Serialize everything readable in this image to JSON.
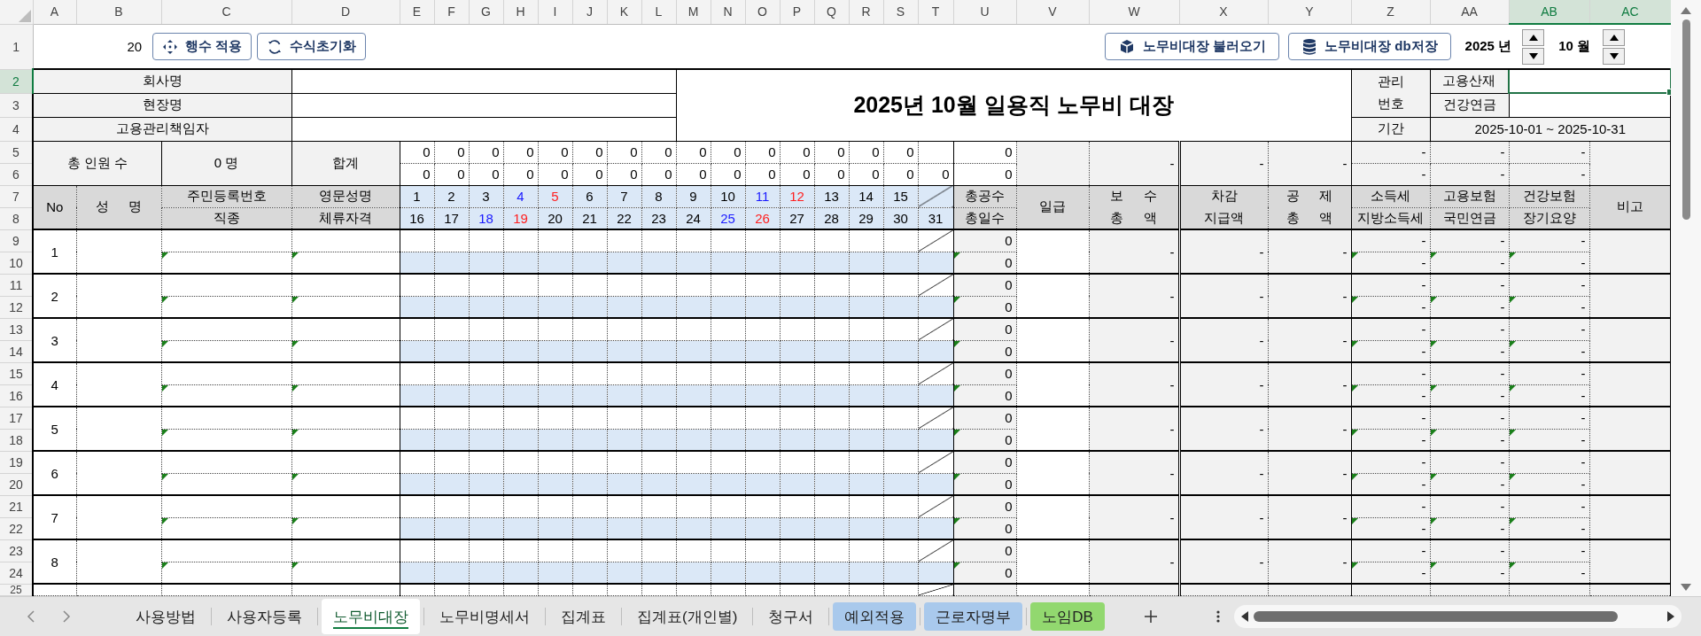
{
  "column_headers": [
    {
      "label": "A",
      "selected": false
    },
    {
      "label": "B",
      "selected": false
    },
    {
      "label": "C",
      "selected": false
    },
    {
      "label": "D",
      "selected": false
    },
    {
      "label": "E",
      "selected": false
    },
    {
      "label": "F",
      "selected": false
    },
    {
      "label": "G",
      "selected": false
    },
    {
      "label": "H",
      "selected": false
    },
    {
      "label": "I",
      "selected": false
    },
    {
      "label": "J",
      "selected": false
    },
    {
      "label": "K",
      "selected": false
    },
    {
      "label": "L",
      "selected": false
    },
    {
      "label": "M",
      "selected": false
    },
    {
      "label": "N",
      "selected": false
    },
    {
      "label": "O",
      "selected": false
    },
    {
      "label": "P",
      "selected": false
    },
    {
      "label": "Q",
      "selected": false
    },
    {
      "label": "R",
      "selected": false
    },
    {
      "label": "S",
      "selected": false
    },
    {
      "label": "T",
      "selected": false
    },
    {
      "label": "U",
      "selected": false
    },
    {
      "label": "V",
      "selected": false
    },
    {
      "label": "W",
      "selected": false
    },
    {
      "label": "X",
      "selected": false
    },
    {
      "label": "Y",
      "selected": false
    },
    {
      "label": "Z",
      "selected": false
    },
    {
      "label": "AA",
      "selected": false
    },
    {
      "label": "AB",
      "selected": true
    },
    {
      "label": "AC",
      "selected": true
    }
  ],
  "row_numbers": [
    {
      "label": "1",
      "selected": false
    },
    {
      "label": "2",
      "selected": true
    },
    {
      "label": "3",
      "selected": false
    },
    {
      "label": "4",
      "selected": false
    },
    {
      "label": "5",
      "selected": false
    },
    {
      "label": "6",
      "selected": false
    },
    {
      "label": "7",
      "selected": false
    },
    {
      "label": "8",
      "selected": false
    },
    {
      "label": "9",
      "selected": false
    },
    {
      "label": "10",
      "selected": false
    },
    {
      "label": "11",
      "selected": false
    },
    {
      "label": "12",
      "selected": false
    },
    {
      "label": "13",
      "selected": false
    },
    {
      "label": "14",
      "selected": false
    },
    {
      "label": "15",
      "selected": false
    },
    {
      "label": "16",
      "selected": false
    },
    {
      "label": "17",
      "selected": false
    },
    {
      "label": "18",
      "selected": false
    },
    {
      "label": "19",
      "selected": false
    },
    {
      "label": "20",
      "selected": false
    },
    {
      "label": "21",
      "selected": false
    },
    {
      "label": "22",
      "selected": false
    },
    {
      "label": "23",
      "selected": false
    },
    {
      "label": "24",
      "selected": false
    },
    {
      "label": "25",
      "selected": false
    }
  ],
  "toolbar": {
    "row_count": "20",
    "apply_rows_button": "행수 적용",
    "reset_formula_button": "수식초기화",
    "load_button": "노무비대장 불러오기",
    "save_db_button": "노무비대장 db저장",
    "year": {
      "value": "2025",
      "unit": "년"
    },
    "month": {
      "value": "10",
      "unit": "월"
    }
  },
  "header_block": {
    "company_label": "회사명",
    "site_label": "현장명",
    "manager_label": "고용관리책임자",
    "title": "2025년 10월 일용직 노무비 대장",
    "mgmt_labels": [
      "관리",
      "번호"
    ],
    "insurance_labels": [
      "고용산재",
      "건강연금"
    ],
    "period_label": "기간",
    "period": "2025-10-01 ~ 2025-10-31"
  },
  "summary": {
    "headcount_label": "총 인원 수",
    "headcount": "0 명",
    "sum_label": "합계",
    "first_half": [
      "0",
      "0",
      "0",
      "0",
      "0",
      "0",
      "0",
      "0",
      "0",
      "0",
      "0",
      "0",
      "0",
      "0",
      "0"
    ],
    "second_half": [
      "0",
      "0",
      "0",
      "0",
      "0",
      "0",
      "0",
      "0",
      "0",
      "0",
      "0",
      "0",
      "0",
      "0",
      "0",
      "0"
    ],
    "total_work": [
      "0",
      "0"
    ],
    "pay_total": "-",
    "net_pay": "-",
    "deduction_total": "-",
    "taxes": [
      [
        "-",
        "-"
      ],
      [
        "-",
        "-"
      ],
      [
        "-",
        "-"
      ]
    ]
  },
  "column_titles": {
    "no": "No",
    "name": "성 명",
    "id_job": [
      "주민등록번호",
      "직종"
    ],
    "eng_visa": [
      "영문성명",
      "체류자격"
    ],
    "work_days": [
      "총공수",
      "총일수"
    ],
    "daily_wage": "일급",
    "pay": [
      "보 수",
      "총 액"
    ],
    "net": [
      "차감",
      "지급액"
    ],
    "deduction": [
      "공 제",
      "총 액"
    ],
    "tax": [
      "소득세",
      "지방소득세"
    ],
    "insurance1": [
      "고용보험",
      "국민연금"
    ],
    "insurance2": [
      "건강보험",
      "장기요양"
    ],
    "note": "비고"
  },
  "days": [
    {
      "label": "1",
      "kind": "weekday"
    },
    {
      "label": "2",
      "kind": "weekday"
    },
    {
      "label": "3",
      "kind": "weekday"
    },
    {
      "label": "4",
      "kind": "saturday"
    },
    {
      "label": "5",
      "kind": "sunday"
    },
    {
      "label": "6",
      "kind": "weekday"
    },
    {
      "label": "7",
      "kind": "weekday"
    },
    {
      "label": "8",
      "kind": "weekday"
    },
    {
      "label": "9",
      "kind": "weekday"
    },
    {
      "label": "10",
      "kind": "weekday"
    },
    {
      "label": "11",
      "kind": "saturday"
    },
    {
      "label": "12",
      "kind": "sunday"
    },
    {
      "label": "13",
      "kind": "weekday"
    },
    {
      "label": "14",
      "kind": "weekday"
    },
    {
      "label": "15",
      "kind": "weekday"
    },
    {
      "label": "16",
      "kind": "weekday"
    },
    {
      "label": "17",
      "kind": "weekday"
    },
    {
      "label": "18",
      "kind": "saturday"
    },
    {
      "label": "19",
      "kind": "sunday"
    },
    {
      "label": "20",
      "kind": "weekday"
    },
    {
      "label": "21",
      "kind": "weekday"
    },
    {
      "label": "22",
      "kind": "weekday"
    },
    {
      "label": "23",
      "kind": "weekday"
    },
    {
      "label": "24",
      "kind": "weekday"
    },
    {
      "label": "25",
      "kind": "saturday"
    },
    {
      "label": "26",
      "kind": "sunday"
    },
    {
      "label": "27",
      "kind": "weekday"
    },
    {
      "label": "28",
      "kind": "weekday"
    },
    {
      "label": "29",
      "kind": "weekday"
    },
    {
      "label": "30",
      "kind": "weekday"
    },
    {
      "label": "31",
      "kind": "weekday"
    }
  ],
  "workers": [
    {
      "no": "1",
      "work": "0",
      "days": "0",
      "pay_total": "-",
      "net_pay": "-",
      "deduction_total": "-",
      "income_tax": "-",
      "local_tax": "-",
      "employment_ins": "-",
      "pension": "-",
      "health_ins": "-",
      "care_ins": "-"
    },
    {
      "no": "2",
      "work": "0",
      "days": "0",
      "pay_total": "-",
      "net_pay": "-",
      "deduction_total": "-",
      "income_tax": "-",
      "local_tax": "-",
      "employment_ins": "-",
      "pension": "-",
      "health_ins": "-",
      "care_ins": "-"
    },
    {
      "no": "3",
      "work": "0",
      "days": "0",
      "pay_total": "-",
      "net_pay": "-",
      "deduction_total": "-",
      "income_tax": "-",
      "local_tax": "-",
      "employment_ins": "-",
      "pension": "-",
      "health_ins": "-",
      "care_ins": "-"
    },
    {
      "no": "4",
      "work": "0",
      "days": "0",
      "pay_total": "-",
      "net_pay": "-",
      "deduction_total": "-",
      "income_tax": "-",
      "local_tax": "-",
      "employment_ins": "-",
      "pension": "-",
      "health_ins": "-",
      "care_ins": "-"
    },
    {
      "no": "5",
      "work": "0",
      "days": "0",
      "pay_total": "-",
      "net_pay": "-",
      "deduction_total": "-",
      "income_tax": "-",
      "local_tax": "-",
      "employment_ins": "-",
      "pension": "-",
      "health_ins": "-",
      "care_ins": "-"
    },
    {
      "no": "6",
      "work": "0",
      "days": "0",
      "pay_total": "-",
      "net_pay": "-",
      "deduction_total": "-",
      "income_tax": "-",
      "local_tax": "-",
      "employment_ins": "-",
      "pension": "-",
      "health_ins": "-",
      "care_ins": "-"
    },
    {
      "no": "7",
      "work": "0",
      "days": "0",
      "pay_total": "-",
      "net_pay": "-",
      "deduction_total": "-",
      "income_tax": "-",
      "local_tax": "-",
      "employment_ins": "-",
      "pension": "-",
      "health_ins": "-",
      "care_ins": "-"
    },
    {
      "no": "8",
      "work": "0",
      "days": "0",
      "pay_total": "-",
      "net_pay": "-",
      "deduction_total": "-",
      "income_tax": "-",
      "local_tax": "-",
      "employment_ins": "-",
      "pension": "-",
      "health_ins": "-",
      "care_ins": "-"
    }
  ],
  "sheet_tabs": [
    {
      "label": "사용방법",
      "selected": false
    },
    {
      "label": "사용자등록",
      "selected": false
    },
    {
      "label": "노무비대장",
      "selected": true
    },
    {
      "label": "노무비명세서",
      "selected": false
    },
    {
      "label": "집계표",
      "selected": false
    },
    {
      "label": "집계표(개인별)",
      "selected": false
    },
    {
      "label": "청구서",
      "selected": false
    },
    {
      "label": "예외적용",
      "selected": false,
      "color": "#a9c9ec"
    },
    {
      "label": "근로자명부",
      "selected": false,
      "color": "#a9c9ec"
    },
    {
      "label": "노임DB",
      "selected": false,
      "color": "#92d86f"
    }
  ]
}
